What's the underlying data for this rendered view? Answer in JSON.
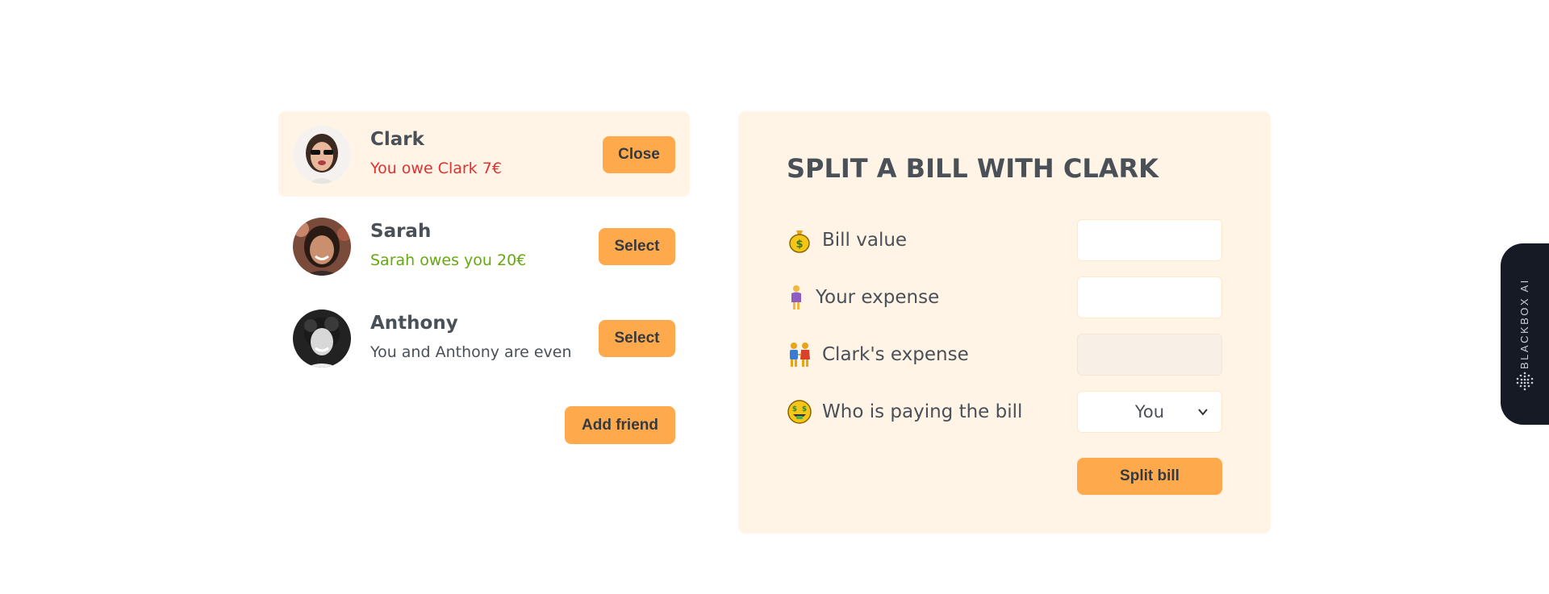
{
  "friends": [
    {
      "name": "Clark",
      "status": "You owe Clark 7€",
      "button": "Close",
      "selected": true
    },
    {
      "name": "Sarah",
      "status": "Sarah owes you 20€",
      "button": "Select",
      "selected": false
    },
    {
      "name": "Anthony",
      "status": "You and Anthony are even",
      "button": "Select",
      "selected": false
    }
  ],
  "add_friend_label": "Add friend",
  "form": {
    "title": "SPLIT A BILL WITH CLARK",
    "bill_value_label": "Bill value",
    "your_expense_label": "Your expense",
    "friend_expense_label": "Clark's expense",
    "payer_label": "Who is paying the bill",
    "payer_value": "You",
    "submit_label": "Split bill",
    "bill_value": "",
    "your_expense": "",
    "friend_expense": ""
  },
  "side_tab": {
    "label": "BLACKBOX AI"
  },
  "colors": {
    "accent": "#ffa94d",
    "panel": "#fff4e6",
    "owe": "#e03131",
    "owed": "#66a80f",
    "text": "#495057"
  },
  "icons": {
    "bill_value": "money-bag-icon",
    "your_expense": "woman-standing-icon",
    "friend_expense": "people-holding-hands-icon",
    "payer": "money-mouth-face-icon",
    "select_arrow": "chevron-down-icon",
    "side_tab_logo": "blackbox-logo-icon"
  }
}
